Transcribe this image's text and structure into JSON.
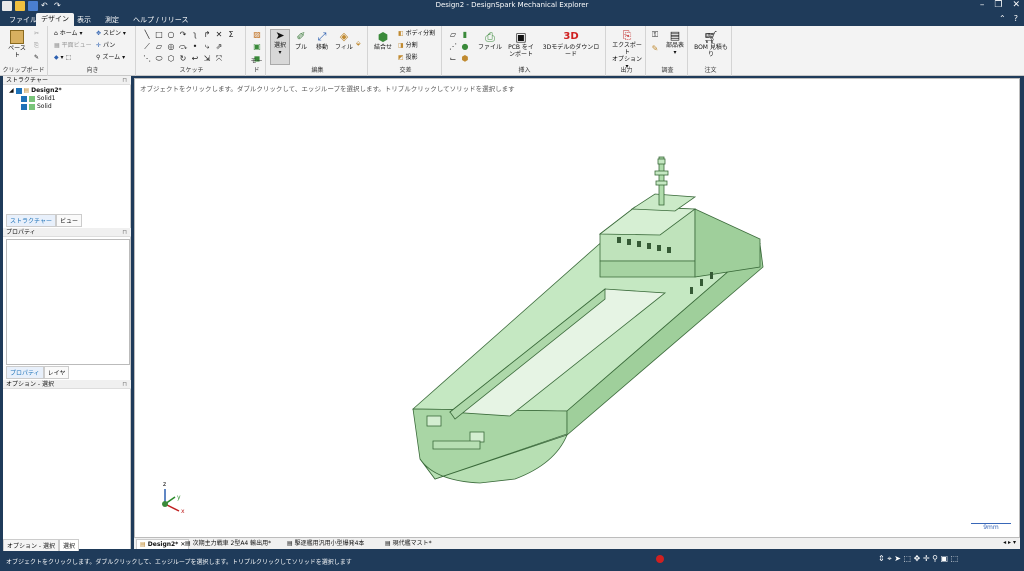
{
  "window": {
    "title": "Design2 - DesignSpark Mechanical Explorer"
  },
  "menu": {
    "tabs": [
      "ファイル",
      "デザイン",
      "表示",
      "測定",
      "ヘルプ / リリース"
    ]
  },
  "ribbon": {
    "clipboard": {
      "label": "クリップボード",
      "paste": "ペースト"
    },
    "orient": {
      "label": "向き",
      "home": "ホーム",
      "plane_view": "平面ビュー",
      "spin": "スピン",
      "pan": "パン",
      "zoom": "ズーム"
    },
    "sketch": {
      "label": "スケッチ"
    },
    "mode": {
      "label": "モード"
    },
    "edit": {
      "label": "編集",
      "select": "選択",
      "pull": "プル",
      "move": "移動",
      "fill": "フィル"
    },
    "intersect": {
      "label": "交差",
      "combine": "結合せ",
      "split_body": "ボディ分割",
      "split": "分割",
      "project": "投影"
    },
    "insert": {
      "label": "挿入",
      "file": "ファイル",
      "pcb": "PCB をインポート",
      "download": "3Dモデルのダウンロード",
      "badge_3d": "3D"
    },
    "output": {
      "label": "出力",
      "export": "エクスポート",
      "options": "オプション"
    },
    "investigate": {
      "label": "調査",
      "parts": "部品表"
    },
    "order": {
      "label": "注文",
      "bom": "BOM 見積もり"
    }
  },
  "structure": {
    "header": "ストラクチャー",
    "root": "Design2*",
    "items": [
      "Solid1",
      "Solid"
    ],
    "tabs": [
      "ストラクチャー",
      "ビュー"
    ]
  },
  "properties": {
    "header": "プロパティ",
    "tabs": [
      "プロパティ",
      "レイヤ"
    ]
  },
  "options": {
    "header": "オプション - 選択",
    "tabs": [
      "オプション - 選択",
      "選択"
    ]
  },
  "viewport": {
    "hint": "オブジェクトをクリックします。ダブルクリックして、エッジループを選択します。トリプルクリックしてソリッドを選択します",
    "scale_label": "9mm",
    "axis_x": "x",
    "axis_y": "y",
    "axis_z": "z"
  },
  "doc_tabs": [
    "Design2*",
    "次期主力戦車 2型A4 輸出用*",
    "駆逐艦用汎用小型爆発4本",
    "現代艦マスト*"
  ],
  "status": {
    "message": "オブジェクトをクリックします。ダブルクリックして、エッジループを選択します。トリプルクリックしてソリッドを選択します"
  },
  "colors": {
    "chrome": "#1f3b5a",
    "ship": "#c5e8c2",
    "ship_edge": "#3a6a3a"
  }
}
